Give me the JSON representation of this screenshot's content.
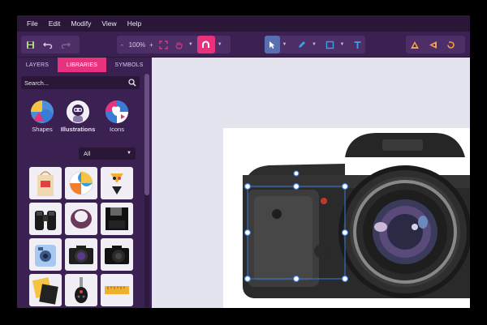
{
  "menu": [
    "File",
    "Edit",
    "Modify",
    "View",
    "Help"
  ],
  "toolbar": {
    "zoom_minus": "-",
    "zoom": "100%",
    "zoom_plus": "+"
  },
  "tabs": [
    "LAYERS",
    "LIBRARIES",
    "SYMBOLS"
  ],
  "active_tab": "LIBRARIES",
  "search": {
    "placeholder": "Search..."
  },
  "categories": [
    {
      "label": "Shapes",
      "icon": "shapes-icon",
      "active": false
    },
    {
      "label": "Illustrations",
      "icon": "illustrations-icon",
      "active": true
    },
    {
      "label": "Icons",
      "icon": "icons-icon",
      "active": false
    }
  ],
  "filter": {
    "selected": "All"
  },
  "library_items": [
    "tote-bag",
    "beach-ball",
    "swimsuit",
    "binoculars",
    "necklace",
    "floppy-disk",
    "instant-camera",
    "camera-front",
    "camera-black",
    "photos",
    "car-key",
    "ruler"
  ],
  "colors": {
    "accent": "#e8327e",
    "panel": "#3b2151",
    "menubar": "#2a1738",
    "selection": "#3a7bd5"
  }
}
